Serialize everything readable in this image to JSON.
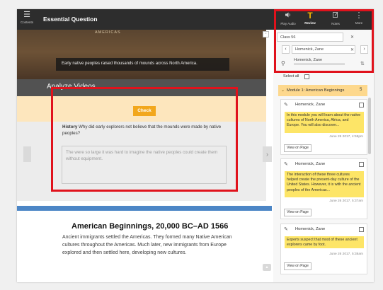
{
  "topbar": {
    "menu_icon": "hamburger-icon",
    "menu_label": "Contents",
    "title": "Essential Question"
  },
  "toolbar": {
    "play_audio": {
      "label": "Play Audio",
      "icon": "speaker-icon"
    },
    "review": {
      "label": "Review",
      "icon": "text-t-icon"
    },
    "notes": {
      "label": "Notes",
      "icon": "notes-icon"
    },
    "more": {
      "label": "More",
      "icon": "more-vertical-icon"
    }
  },
  "hero": {
    "top_text": "AMERICAS",
    "caption": "Early native peoples raised thousands of mounds across North America."
  },
  "analyze": {
    "heading": "Analyze Videos",
    "check_label": "Check",
    "question_prefix": "History",
    "question_text": " Why did early explorers not believe that the mounds were made by native peoples?",
    "answer_value": "The were so large it was hard to imagine the native peoples could create them without equipment."
  },
  "section": {
    "title": "American Beginnings, 20,000 BC–AD 1566",
    "body": "Ancient immigrants settled the Americas. They formed many Native American cultures throughout the Americas. Much later, new immigrants from Europe explored and then settled here, developing new cultures."
  },
  "review_panel": {
    "class_value": "Class 56",
    "student_value": "Homenick, Zane",
    "search_value": "Homenick, Zane",
    "select_all_label": "Select all",
    "module_label": "Module 1: American Beginnings",
    "module_count": "5",
    "notes": [
      {
        "name": "Homenick, Zane",
        "text": "In this module you will learn about the native cultures of North America, Africa, and Europe. You will also discover...",
        "date": "June 26 2017, 4:59pm",
        "button": "View on Page"
      },
      {
        "name": "Homenick, Zane",
        "text": "The interaction of these three cultures helped create the present-day culture of the United States. However, it is with the ancient peoples of the Americas...",
        "date": "June 26 2017, 5:37am",
        "button": "View on Page"
      },
      {
        "name": "Homenick, Zane",
        "text": "Experts suspect that most of these ancient explorers came by foot.",
        "date": "June 26 2017, 5:38am",
        "button": "View on Page"
      }
    ]
  },
  "colors": {
    "highlight_red": "#e0121c",
    "accent_orange": "#f2a71c",
    "note_yellow": "#fde567",
    "module_yellow": "#fdd88d",
    "blue_bar": "#4c86c6"
  }
}
